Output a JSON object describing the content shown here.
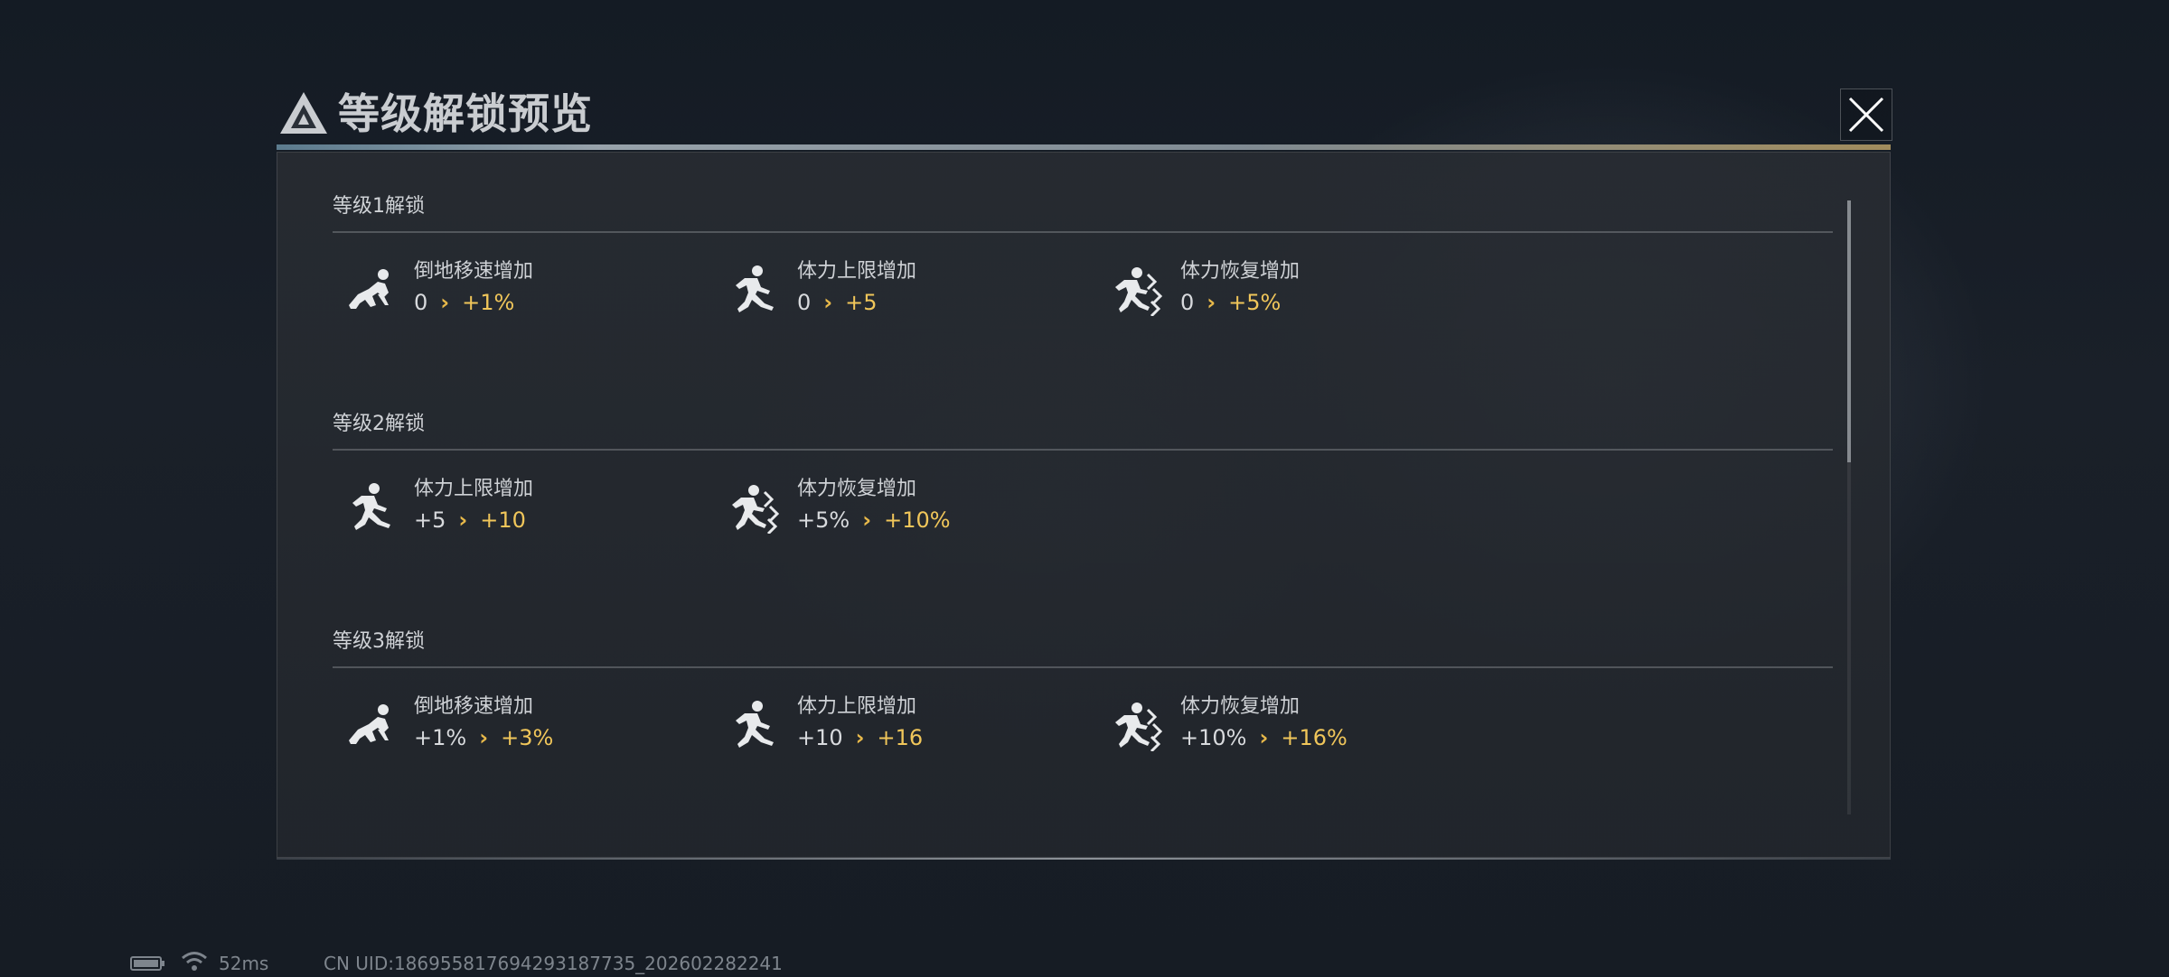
{
  "dialog": {
    "title": "等级解锁预览",
    "close_icon": "close-icon",
    "logo_icon": "triangle-logo-icon"
  },
  "sections": [
    {
      "title": "等级1解锁",
      "items": [
        {
          "icon": "crawl-icon",
          "name": "倒地移速增加",
          "from": "0",
          "to": "+1%"
        },
        {
          "icon": "run-icon",
          "name": "体力上限增加",
          "from": "0",
          "to": "+5"
        },
        {
          "icon": "sprint-recover-icon",
          "name": "体力恢复增加",
          "from": "0",
          "to": "+5%"
        }
      ]
    },
    {
      "title": "等级2解锁",
      "items": [
        {
          "icon": "run-icon",
          "name": "体力上限增加",
          "from": "+5",
          "to": "+10"
        },
        {
          "icon": "sprint-recover-icon",
          "name": "体力恢复增加",
          "from": "+5%",
          "to": "+10%"
        }
      ]
    },
    {
      "title": "等级3解锁",
      "items": [
        {
          "icon": "crawl-icon",
          "name": "倒地移速增加",
          "from": "+1%",
          "to": "+3%"
        },
        {
          "icon": "run-icon",
          "name": "体力上限增加",
          "from": "+10",
          "to": "+16"
        },
        {
          "icon": "sprint-recover-icon",
          "name": "体力恢复增加",
          "from": "+10%",
          "to": "+16%"
        }
      ]
    }
  ],
  "arrow_glyph": "›",
  "footer": {
    "ping": "52ms",
    "uid": "CN UID:186955817694293187735_202602282241"
  },
  "colors": {
    "accent_gold": "#f0c65a",
    "text": "#d8dadd"
  }
}
